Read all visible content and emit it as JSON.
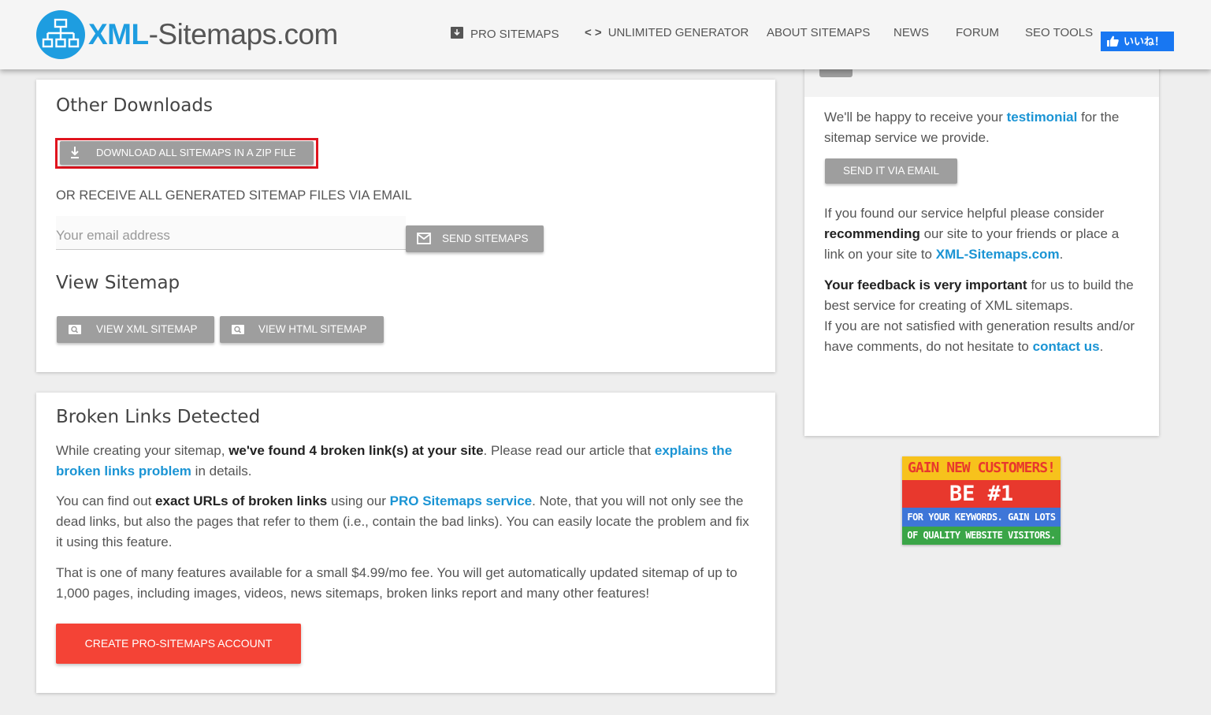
{
  "header": {
    "logo_brand_a": "XML",
    "logo_brand_b": "-Sitemaps.com",
    "nav": [
      {
        "label": "PRO SITEMAPS"
      },
      {
        "label": "UNLIMITED GENERATOR"
      },
      {
        "label": "ABOUT SITEMAPS"
      },
      {
        "label": "NEWS"
      },
      {
        "label": "FORUM"
      },
      {
        "label": "SEO TOOLS"
      }
    ],
    "like_label": "いいね！"
  },
  "downloads": {
    "title": "Other Downloads",
    "zip_button": "DOWNLOAD ALL SITEMAPS IN A ZIP FILE",
    "email_heading": "OR RECEIVE ALL GENERATED SITEMAP FILES VIA EMAIL",
    "email_placeholder": "Your email address",
    "send_button": "SEND SITEMAPS"
  },
  "view": {
    "title": "View Sitemap",
    "xml_button": "VIEW XML SITEMAP",
    "html_button": "VIEW HTML SITEMAP"
  },
  "broken": {
    "title": "Broken Links Detected",
    "p1_a": "While creating your sitemap, ",
    "p1_b": "we've found 4 broken link(s) at your site",
    "p1_c": ". Please read our article that ",
    "p1_link": "explains the broken links problem",
    "p1_d": " in details.",
    "p2_a": "You can find out ",
    "p2_b": "exact URLs of broken links",
    "p2_c": " using our ",
    "p2_link": "PRO Sitemaps service",
    "p2_d": ". Note, that you will not only see the dead links, but also the pages that refer to them (i.e., contain the bad links). You can easily locate the problem and fix it using this feature.",
    "p3": "That is one of many features available for a small $4.99/mo fee. You will get automatically updated sitemap of up to 1,000 pages, including images, videos, news sitemaps, broken links report and many other features!",
    "create_button": "CREATE PRO-SITEMAPS ACCOUNT"
  },
  "sidebar": {
    "t1_a": "We'll be happy to receive your ",
    "t1_link": "testimonial",
    "t1_b": " for the sitemap service we provide.",
    "email_button": "SEND IT VIA EMAIL",
    "t2_a": "If you found our service helpful please consider ",
    "t2_b": "recommending",
    "t2_c": " our site to your friends or place a link on your site to ",
    "t2_link": "XML-Sitemaps.com",
    "t2_d": ".",
    "t3_a": "Your feedback is very important",
    "t3_b": " for us to build the best service for creating of XML sitemaps.",
    "t3_c": "If you are not satisfied with generation results and/or have comments, do not hesitate to ",
    "t3_link": "contact us",
    "t3_d": "."
  },
  "ad": {
    "line1": "GAIN NEW CUSTOMERS!",
    "line2": "BE #1",
    "line3": "FOR YOUR KEYWORDS. GAIN LOTS",
    "line4": "OF QUALITY WEBSITE VISITORS."
  },
  "colors": {
    "brand_blue": "#1e9de0",
    "link_blue": "#1a94d4",
    "button_gray": "#9e9e9e",
    "cta_red": "#f44336",
    "highlight_red": "#e0141e"
  }
}
